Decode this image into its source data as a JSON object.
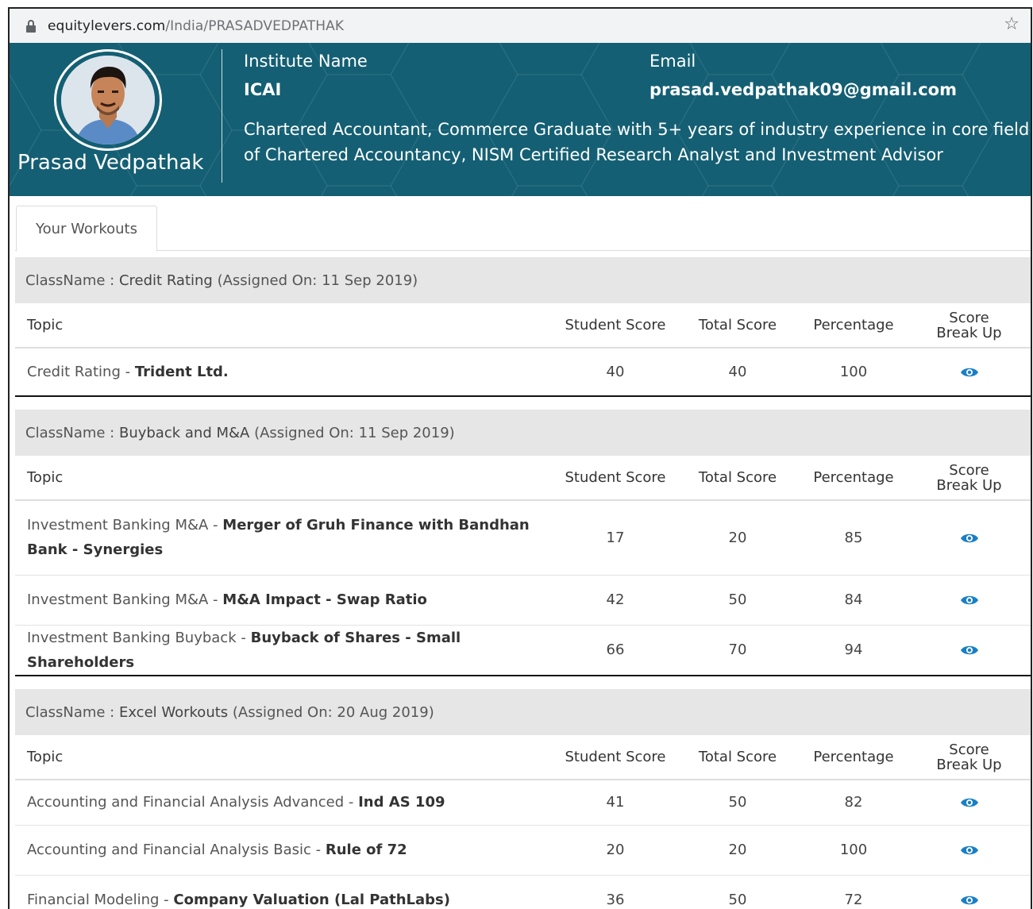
{
  "browser": {
    "url_domain": "equitylevers.com",
    "url_path": "/India/PRASADVEDPATHAK"
  },
  "profile": {
    "name": "Prasad Vedpathak",
    "institute_label": "Institute Name",
    "institute": "ICAI",
    "email_label": "Email",
    "email": "prasad.vedpathak09@gmail.com",
    "bio": "Chartered Accountant, Commerce Graduate with 5+ years of industry experience in core field of Chartered Accountancy, NISM Certified Research Analyst and Investment Advisor"
  },
  "tabs": [
    {
      "label": "Your Workouts"
    }
  ],
  "columns": {
    "topic": "Topic",
    "student_score": "Student Score",
    "total_score": "Total Score",
    "percentage": "Percentage",
    "score_line1": "Score",
    "score_line2": "Break Up"
  },
  "classes": [
    {
      "prefix": "ClassName : ",
      "name": "Credit Rating",
      "assigned": " (Assigned On: 11 Sep 2019)",
      "rows": [
        {
          "category": "Credit Rating",
          "sep": " - ",
          "title": "Trident Ltd.",
          "student_score": "40",
          "total_score": "40",
          "percentage": "100"
        }
      ]
    },
    {
      "prefix": "ClassName : ",
      "name": "Buyback and M&A",
      "assigned": " (Assigned On: 11 Sep 2019)",
      "rows": [
        {
          "category": "Investment Banking M&A",
          "sep": " - ",
          "title": "Merger of Gruh Finance with Bandhan Bank - Synergies",
          "student_score": "17",
          "total_score": "20",
          "percentage": "85"
        },
        {
          "category": "Investment Banking M&A",
          "sep": " - ",
          "title": "M&A Impact - Swap Ratio",
          "student_score": "42",
          "total_score": "50",
          "percentage": "84"
        },
        {
          "category": "Investment Banking Buyback",
          "sep": " - ",
          "title": "Buyback of Shares - Small Shareholders",
          "student_score": "66",
          "total_score": "70",
          "percentage": "94"
        }
      ]
    },
    {
      "prefix": "ClassName : ",
      "name": "Excel Workouts",
      "assigned": " (Assigned On: 20 Aug 2019)",
      "rows": [
        {
          "category": "Accounting and Financial Analysis Advanced",
          "sep": " - ",
          "title": "Ind AS 109",
          "student_score": "41",
          "total_score": "50",
          "percentage": "82"
        },
        {
          "category": "Accounting and Financial Analysis Basic",
          "sep": " - ",
          "title": "Rule of 72",
          "student_score": "20",
          "total_score": "20",
          "percentage": "100"
        },
        {
          "category": "Financial Modeling",
          "sep": " - ",
          "title": "Company Valuation (Lal PathLabs)",
          "student_score": "36",
          "total_score": "50",
          "percentage": "72"
        }
      ]
    }
  ],
  "icons": {
    "lock": "lock-icon",
    "star": "bookmark-star-icon",
    "eye": "eye-icon"
  },
  "colors": {
    "banner": "#145f73",
    "eye": "#1a7fc4",
    "class_header": "#e6e6e6"
  }
}
